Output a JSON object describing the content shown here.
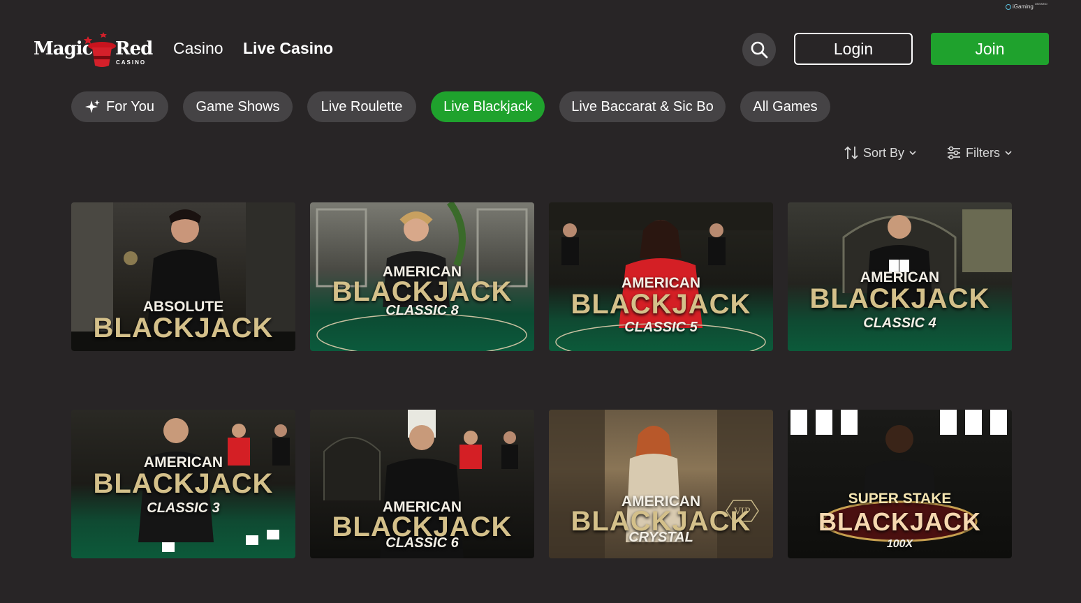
{
  "badge": {
    "text": "iGaming",
    "sup": "ONTARIO"
  },
  "header": {
    "logo_left": "Magic",
    "logo_right": "Red",
    "logo_sub": "CASINO",
    "nav": [
      {
        "label": "Casino"
      },
      {
        "label": "Live Casino"
      }
    ],
    "login_label": "Login",
    "join_label": "Join"
  },
  "tabs": [
    {
      "label": "For You",
      "icon": "sparkle-icon"
    },
    {
      "label": "Game Shows"
    },
    {
      "label": "Live Roulette"
    },
    {
      "label": "Live Blackjack",
      "active": true
    },
    {
      "label": "Live Baccarat & Sic Bo"
    },
    {
      "label": "All Games"
    }
  ],
  "sort_label": "Sort By",
  "filters_label": "Filters",
  "colors": {
    "accent": "#1fa22d",
    "background": "#282526",
    "pill": "#454345",
    "gold": "#d4c08a"
  },
  "games": [
    {
      "top": "ABSOLUTE",
      "main": "BLACKJACK",
      "sub": ""
    },
    {
      "top": "AMERICAN",
      "main": "BLACKJACK",
      "sub": "CLASSIC 8"
    },
    {
      "top": "AMERICAN",
      "main": "BLACKJACK",
      "sub": "CLASSIC 5"
    },
    {
      "top": "AMERICAN",
      "main": "BLACKJACK",
      "sub": "CLASSIC 4"
    },
    {
      "top": "AMERICAN",
      "main": "BLACKJACK",
      "sub": "CLASSIC 3"
    },
    {
      "top": "AMERICAN",
      "main": "BLACKJACK",
      "sub": "CLASSIC 6"
    },
    {
      "top": "AMERICAN",
      "main": "BLACKJACK",
      "sub": "CRYSTAL"
    },
    {
      "top": "SUPER STAKE",
      "main": "BLACKJACK",
      "sub": "100X"
    }
  ]
}
